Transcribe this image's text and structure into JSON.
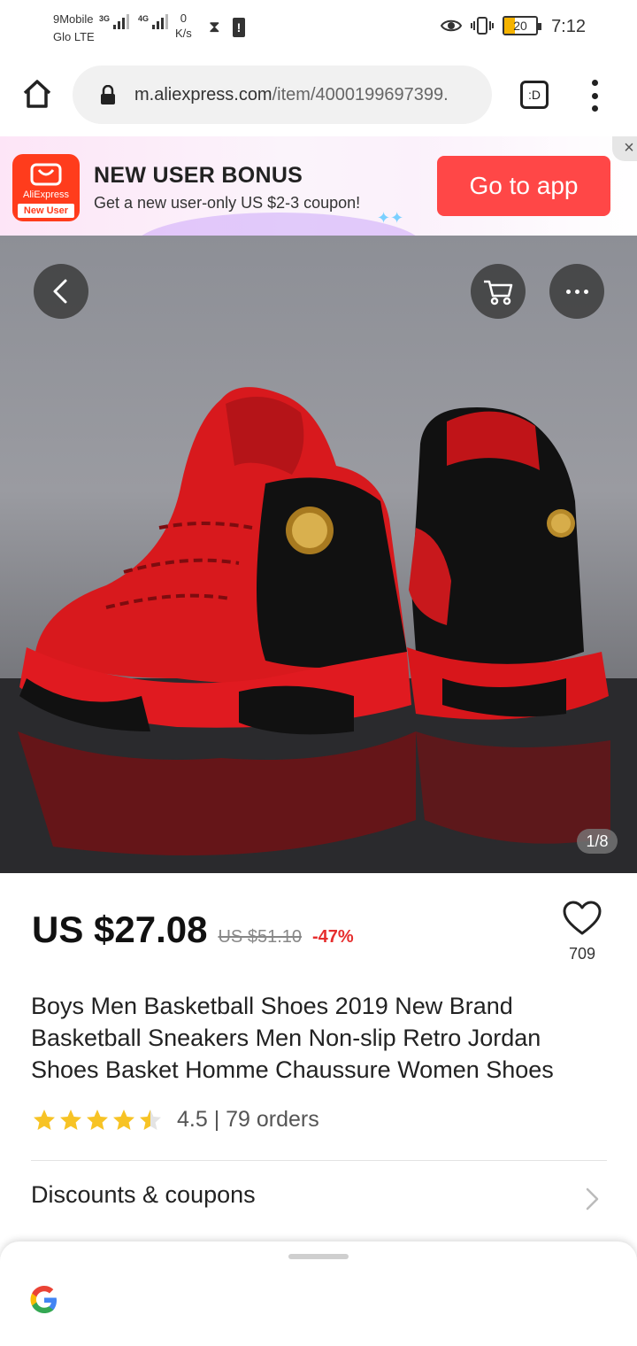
{
  "status_bar": {
    "carrier1": "9Mobile",
    "carrier2": "Glo LTE",
    "net1": "3G",
    "net2": "4G",
    "speed_value": "0",
    "speed_unit": "K/s",
    "battery": "20",
    "time": "7:12"
  },
  "browser": {
    "url_domain": "m.aliexpress.com",
    "url_path": "/item/4000199697399.",
    "tab_label": ":D"
  },
  "banner": {
    "logo_name": "AliExpress",
    "logo_tag": "New User",
    "title": "NEW USER BONUS",
    "subtitle": "Get a new user-only US $2-3 coupon!",
    "cta": "Go to app",
    "close": "×"
  },
  "gallery": {
    "counter": "1/8"
  },
  "product": {
    "price": "US $27.08",
    "price_old": "US $51.10",
    "discount": "-47%",
    "wishlist_count": "709",
    "title": "Boys Men Basketball Shoes 2019 New Brand Basketball Sneakers Men Non-slip Retro Jordan Shoes Basket Homme Chaussure Women Shoes",
    "rating": 4.5,
    "rating_text": "4.5 | 79 orders",
    "coupons_label": "Discounts & coupons"
  },
  "colors": {
    "accent": "#ff4747",
    "discount": "#e62e2e",
    "star": "#f7c325"
  },
  "icons": [
    "home-icon",
    "lock-icon",
    "tabs-icon",
    "more-vert-icon",
    "close-icon",
    "back-arrow-icon",
    "cart-icon",
    "more-horiz-icon",
    "heart-icon",
    "star-icon",
    "chevron-right-icon",
    "google-icon"
  ]
}
